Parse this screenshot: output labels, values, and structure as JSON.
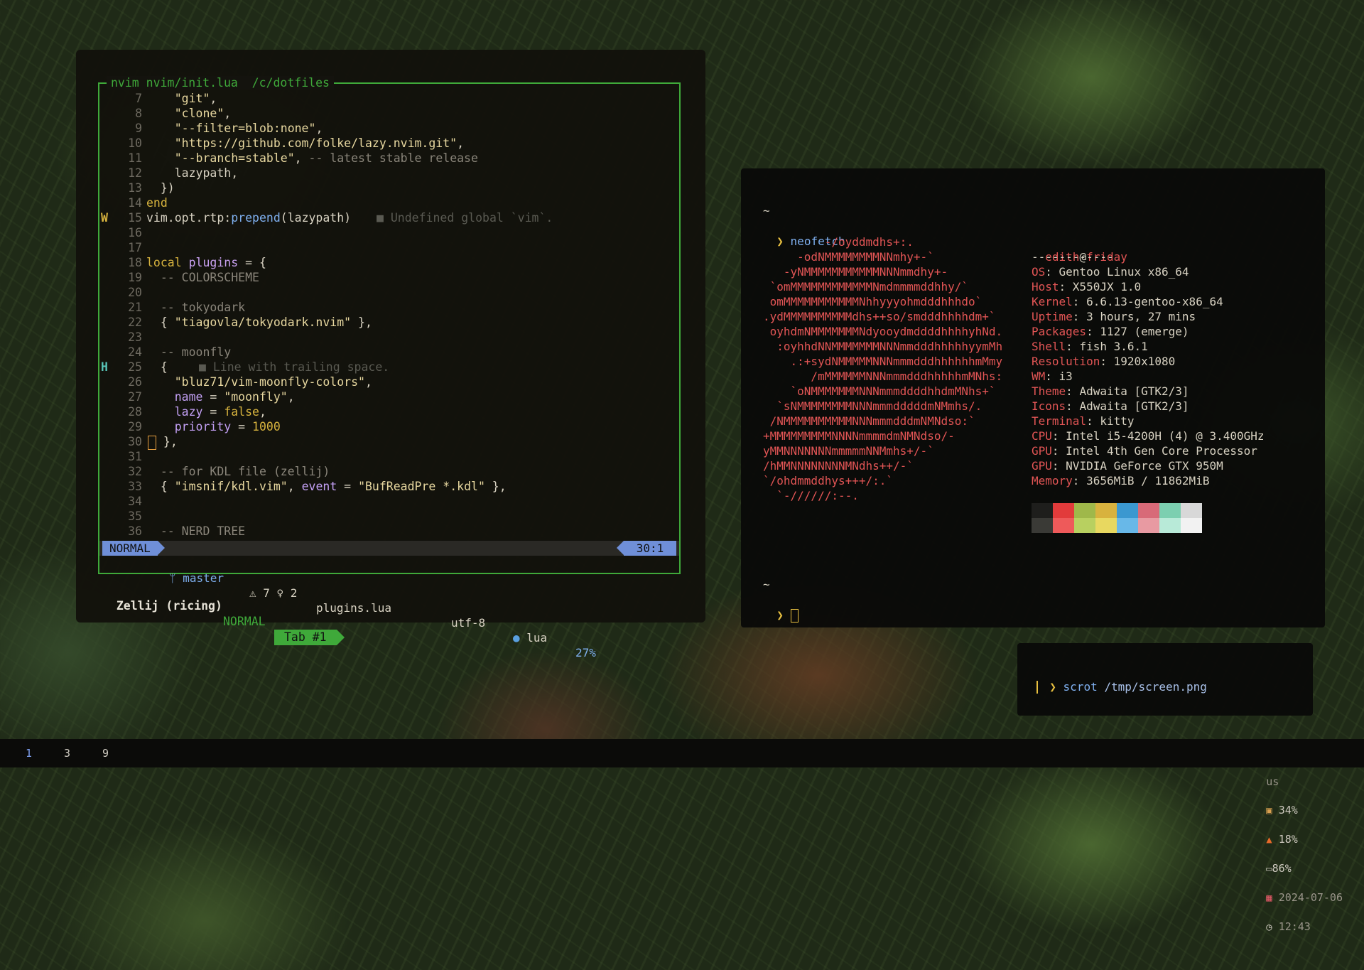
{
  "nvim": {
    "title": "nvim nvim/init.lua  /c/dotfiles",
    "diagnostic_warning": "■ Undefined global `vim`.",
    "diagnostic_hint": "■ Line with trailing space.",
    "lines": [
      {
        "n": "7",
        "t": "    \"git\","
      },
      {
        "n": "8",
        "t": "    \"clone\","
      },
      {
        "n": "9",
        "t": "    \"--filter=blob:none\","
      },
      {
        "n": "10",
        "t": "    \"https://github.com/folke/lazy.nvim.git\","
      },
      {
        "n": "11",
        "t": "    \"--branch=stable\", -- latest stable release"
      },
      {
        "n": "12",
        "t": "    lazypath,"
      },
      {
        "n": "13",
        "t": "  })"
      },
      {
        "n": "14",
        "t": "end"
      },
      {
        "n": "15",
        "t": "vim.opt.rtp:prepend(lazypath)",
        "sign": "W"
      },
      {
        "n": "16",
        "t": ""
      },
      {
        "n": "17",
        "t": ""
      },
      {
        "n": "18",
        "t": "local plugins = {"
      },
      {
        "n": "19",
        "t": "  -- COLORSCHEME"
      },
      {
        "n": "20",
        "t": ""
      },
      {
        "n": "21",
        "t": "  -- tokyodark"
      },
      {
        "n": "22",
        "t": "  { \"tiagovla/tokyodark.nvim\" },"
      },
      {
        "n": "23",
        "t": ""
      },
      {
        "n": "24",
        "t": "  -- moonfly"
      },
      {
        "n": "25",
        "t": "  {",
        "sign": "H"
      },
      {
        "n": "26",
        "t": "    \"bluz71/vim-moonfly-colors\","
      },
      {
        "n": "27",
        "t": "    name = \"moonfly\","
      },
      {
        "n": "28",
        "t": "    lazy = false,"
      },
      {
        "n": "29",
        "t": "    priority = 1000"
      },
      {
        "n": "30",
        "t": " },"
      },
      {
        "n": "31",
        "t": ""
      },
      {
        "n": "32",
        "t": "  -- for KDL file (zellij)"
      },
      {
        "n": "33",
        "t": "  { \"imsnif/kdl.vim\", event = \"BufReadPre *.kdl\" },"
      },
      {
        "n": "34",
        "t": ""
      },
      {
        "n": "35",
        "t": ""
      },
      {
        "n": "36",
        "t": "  -- NERD TREE"
      }
    ],
    "status": {
      "mode": "NORMAL",
      "branch": "ᛘ master",
      "diagnostics": "⚠ 7 ♀ 2",
      "file": "plugins.lua",
      "encoding": "utf-8",
      "lang": "lua",
      "percent": "27%",
      "position": "30:1"
    }
  },
  "zellij": {
    "session": "Zellij (ricing)",
    "mode": "NORMAL",
    "tab": "Tab #1"
  },
  "neofetch": {
    "prompt_symbol": "❯",
    "tilde": "~",
    "command": "neofetch",
    "user": "edith",
    "at": "@",
    "host": "friday",
    "separator": "------------",
    "art": [
      "         -/oyddmdhs+:.",
      "     -odNMMMMMMMMNNmhy+-`",
      "   -yNMMMMMMMMMMMNNNmmdhy+-",
      " `omMMMMMMMMMMMMNmdmmmmddhhy/`",
      " omMMMMMMMMMMMNhhyyyohmdddhhhdo`",
      ".ydMMMMMMMMMMdhs++so/smdddhhhhdm+`",
      " oyhdmNMMMMMMMNdyooydmddddhhhhyhNd.",
      "  :oyhhdNNMMMMMMMNNNmmdddhhhhhyymMh",
      "    .:+sydNMMMMMNNNmmmdddhhhhhhmMmy",
      "       /mMMMMMMNNNmmmdddhhhhhmMNhs:",
      "    `oNMMMMMMMNNNmmmddddhhdmMNhs+`",
      "  `sNMMMMMMMMNNNmmmdddddmNMmhs/.",
      " /NMMMMMMMMMMNNNmmmdddmNMNdso:`",
      "+MMMMMMMMMNNNNmmmmdmNMNdso/-",
      "yMMNNNNNNNmmmmmNNMmhs+/-`",
      "/hMMNNNNNNNNMNdhs++/-`",
      "`/ohdmmddhys+++/:.`",
      "  `-//////:--."
    ],
    "info": [
      {
        "k": "OS",
        "v": "Gentoo Linux x86_64"
      },
      {
        "k": "Host",
        "v": "X550JX 1.0"
      },
      {
        "k": "Kernel",
        "v": "6.6.13-gentoo-x86_64"
      },
      {
        "k": "Uptime",
        "v": "3 hours, 27 mins"
      },
      {
        "k": "Packages",
        "v": "1127 (emerge)"
      },
      {
        "k": "Shell",
        "v": "fish 3.6.1"
      },
      {
        "k": "Resolution",
        "v": "1920x1080"
      },
      {
        "k": "WM",
        "v": "i3"
      },
      {
        "k": "Theme",
        "v": "Adwaita [GTK2/3]"
      },
      {
        "k": "Icons",
        "v": "Adwaita [GTK2/3]"
      },
      {
        "k": "Terminal",
        "v": "kitty"
      },
      {
        "k": "CPU",
        "v": "Intel i5-4200H (4) @ 3.400GHz"
      },
      {
        "k": "GPU",
        "v": "Intel 4th Gen Core Processor"
      },
      {
        "k": "GPU",
        "v": "NVIDIA GeForce GTX 950M"
      },
      {
        "k": "Memory",
        "v": "3656MiB / 11862MiB"
      }
    ],
    "palette_top": [
      "#1e1e1c",
      "#e23b3b",
      "#9fb84a",
      "#d8b23e",
      "#3b98d0",
      "#d86a78",
      "#7ccfb0",
      "#d8d8d8"
    ],
    "palette_bottom": [
      "#3a3a36",
      "#ee5a5a",
      "#b8d060",
      "#e8d860",
      "#68b8e8",
      "#e89aa2",
      "#b8ead8",
      "#f2f2f2"
    ]
  },
  "scrot": {
    "prompt_symbol": "❯",
    "command": "scrot",
    "args": "/tmp/screen.png"
  },
  "bar": {
    "workspaces": [
      "1",
      "3",
      "9"
    ],
    "active_workspace": "1",
    "layout": "us",
    "cpu": "34%",
    "temp": "18%",
    "battery": "86%",
    "date": "2024-07-06",
    "time": "12:43"
  },
  "colors": {
    "accent_green": "#3fa93a",
    "status_blue": "#6f8fd8",
    "neofetch_red": "#e25555"
  }
}
